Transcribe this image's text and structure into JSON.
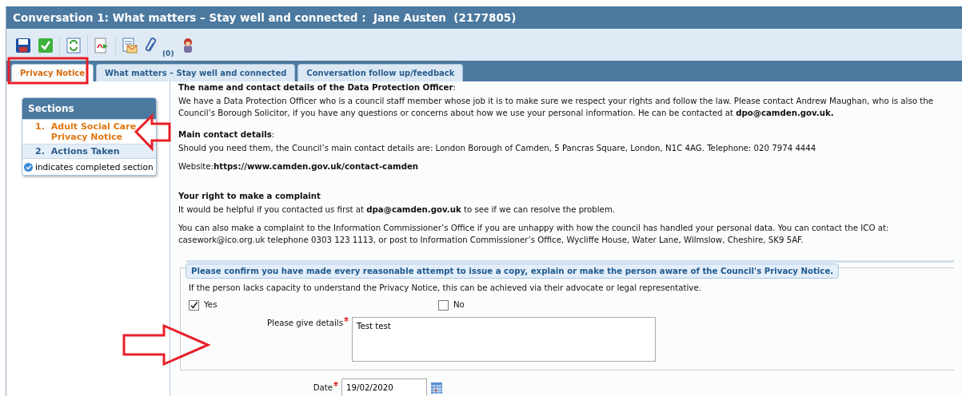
{
  "window": {
    "title": "Conversation 1: What matters – Stay well and connected :  Jane Austen  (2177805)"
  },
  "toolbar": {
    "attachments_count": "(0)"
  },
  "tabs": [
    {
      "label": "Privacy Notice",
      "selected": true
    },
    {
      "label": "What matters – Stay well and connected",
      "selected": false
    },
    {
      "label": "Conversation follow up/feedback",
      "selected": false
    }
  ],
  "sections": {
    "title": "Sections",
    "items": [
      {
        "number": "1.",
        "label": "Adult Social Care Privacy Notice",
        "selected": true
      },
      {
        "number": "2.",
        "label": "Actions Taken",
        "selected": false
      }
    ],
    "legend": "indicates completed section"
  },
  "content": [
    {
      "kind": "heading",
      "text": "**The name and contact details of the Data Protection Officer**:"
    },
    {
      "kind": "paragraph",
      "text": "We have a Data Protection Officer who is a council staff member whose job it is to make sure we respect your rights and follow the law. Please contact Andrew Maughan, who is also the Council’s Borough Solicitor, if you have any questions or concerns about how we use your personal information. He can be contacted at **dpo@camden.gov.uk.**"
    },
    {
      "kind": "heading",
      "text": "**Main contact details**:"
    },
    {
      "kind": "paragraph",
      "text": "Should you need them, the Council’s main contact details are: London Borough of Camden, 5 Pancras Square, London, N1C 4AG. Telephone: 020 7974 4444"
    },
    {
      "kind": "line",
      "text": "Website:**https://www.camden.gov.uk/contact-camden**"
    },
    {
      "kind": "heading",
      "text": "**Your right to make a complaint**"
    },
    {
      "kind": "paragraph",
      "text": "It would be helpful if you contacted us first at **dpa@camden.gov.uk** to see if we can resolve the problem."
    },
    {
      "kind": "paragraph",
      "text": "You can also make a complaint to the Information Commissioner’s Office if you are unhappy with how the council has handled your personal data. You can contact the ICO at: casework@ico.org.uk telephone 0303 123 1113, or post to Information Commissioner’s Office, Wycliffe House, Water Lane, Wilmslow, Cheshire, SK9 5AF."
    }
  ],
  "confirm": {
    "legend": "Please confirm you have made every reasonable attempt to issue a copy, explain or make the person aware of the Council's Privacy Notice.",
    "hint": "If the person lacks capacity to understand the Privacy Notice, this can be achieved via their advocate or legal representative.",
    "options": [
      {
        "label": "Yes",
        "checked": true
      },
      {
        "label": "No",
        "checked": false
      }
    ],
    "details": {
      "label": "Please give details",
      "required": true,
      "value": "Test test"
    },
    "date": {
      "label": "Date",
      "required": true,
      "value": "19/02/2020"
    }
  }
}
